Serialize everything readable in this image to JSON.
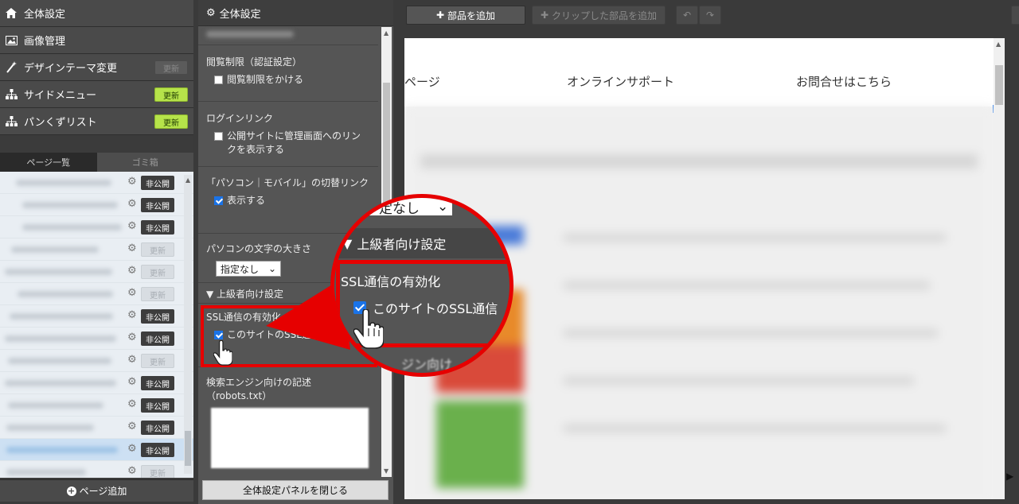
{
  "left": {
    "nav": [
      {
        "label": "全体設定",
        "icon": "home-icon",
        "update": null
      },
      {
        "label": "画像管理",
        "icon": "image-icon",
        "update": null
      },
      {
        "label": "デザインテーマ変更",
        "icon": "magic-wand-icon",
        "update": "更新",
        "update_active": false
      },
      {
        "label": "サイドメニュー",
        "icon": "sitemap-icon",
        "update": "更新",
        "update_active": true
      },
      {
        "label": "パンくずリスト",
        "icon": "sitemap-icon",
        "update": "更新",
        "update_active": true
      }
    ],
    "tabs": {
      "pages": "ページ一覧",
      "trash": "ゴミ箱"
    },
    "rows": [
      {
        "status": "非公開"
      },
      {
        "status": "非公開"
      },
      {
        "status": "非公開"
      },
      {
        "status": "更新"
      },
      {
        "status": "更新"
      },
      {
        "status": "更新"
      },
      {
        "status": "非公開"
      },
      {
        "status": "非公開"
      },
      {
        "status": "更新"
      },
      {
        "status": "非公開"
      },
      {
        "status": "非公開"
      },
      {
        "status": "非公開"
      },
      {
        "status": "非公開"
      },
      {
        "status": "更新"
      }
    ],
    "add_page": "ページ追加"
  },
  "mid": {
    "title": "全体設定",
    "access_title": "閲覧制限（認証設定）",
    "access_cb": "閲覧制限をかける",
    "login_title": "ログインリンク",
    "login_cb": "公開サイトに管理画面へのリンクを表示する",
    "switch_title": "「パソコン｜モバイル」の切替リンク",
    "switch_cb": "表示する",
    "font_title": "パソコンの文字の大きさ",
    "font_value": "指定なし",
    "advanced": "▼ 上級者向け設定",
    "ssl_title": "SSL通信の有効化",
    "ssl_cb": "このサイトのSSL通信を有効",
    "robots_title": "検索エンジン向けの記述",
    "robots_sub": "（robots.txt）",
    "close": "全体設定パネルを閉じる"
  },
  "toolbar": {
    "add_part": "部品を追加",
    "clip_part": "クリップした部品を追加"
  },
  "preview": {
    "nav": [
      "ページ",
      "オンラインサポート",
      "お問合せはこちら"
    ]
  },
  "zoom": {
    "select": "定なし",
    "advanced": "上級者向け設定",
    "ssl_title": "SSL通信の有効化",
    "ssl_cb": "このサイトのSSL通信",
    "bottom": "ジン向け"
  }
}
